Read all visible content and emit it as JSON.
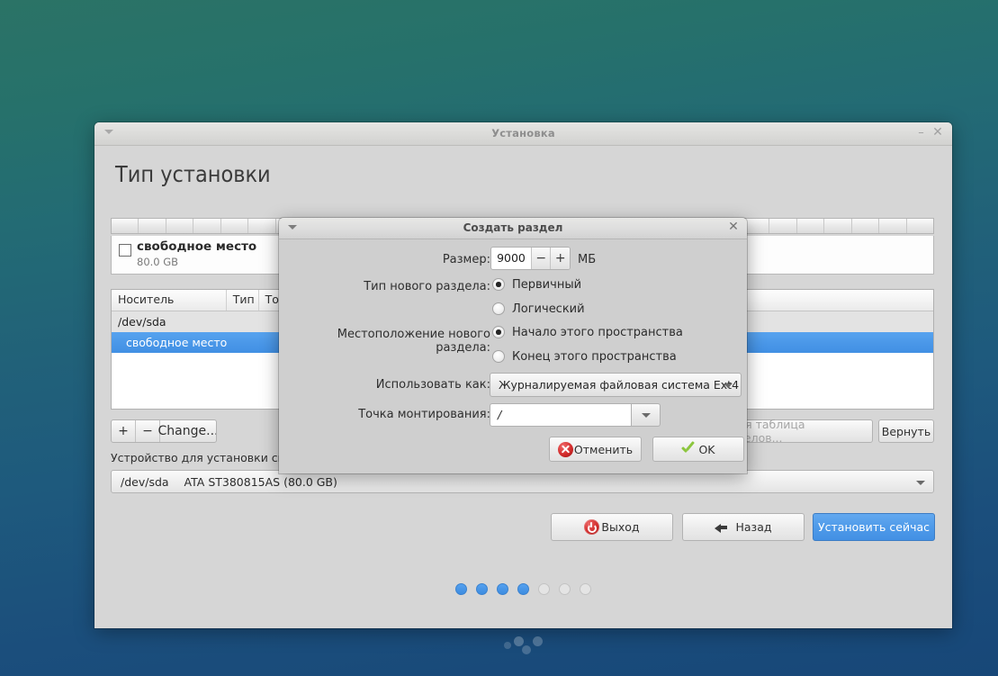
{
  "window": {
    "title": "Установка",
    "page_title": "Тип установки",
    "minimize_icon": "minimize-icon",
    "close_icon": "close-icon",
    "menu_icon": "window-menu-icon"
  },
  "legend": {
    "name": "свободное место",
    "size": "80.0 GB"
  },
  "table": {
    "columns": [
      "Носитель",
      "Тип",
      "Точ"
    ],
    "rows": [
      {
        "name": "/dev/sda",
        "type": "",
        "mount": "",
        "selected": false
      },
      {
        "name": "свободное место",
        "type": "",
        "mount": "",
        "selected": true
      }
    ]
  },
  "toolbar": {
    "add_label": "+",
    "remove_label": "−",
    "change_label": "Change...",
    "new_table_label": "Новая таблица разделов...",
    "revert_label": "Вернуть"
  },
  "device": {
    "label": "Устройство для установки системного загрузчика:",
    "selected_dev": "/dev/sda",
    "selected_desc": "ATA ST380815AS (80.0 GB)"
  },
  "nav": {
    "quit_label": "Выход",
    "back_label": "Назад",
    "install_label": "Установить сейчас",
    "quit_icon": "power-icon",
    "back_icon": "arrow-left-icon"
  },
  "dots": {
    "total": 7,
    "active": 4
  },
  "dialog": {
    "title": "Создать раздел",
    "close_icon": "close-icon",
    "menu_icon": "window-menu-icon",
    "size": {
      "label": "Размер:",
      "value": "9000",
      "unit": "МБ",
      "decrement": "−",
      "increment": "+"
    },
    "part_type": {
      "label": "Тип нового раздела:",
      "options": [
        {
          "label": "Первичный",
          "checked": true
        },
        {
          "label": "Логический",
          "checked": false
        }
      ]
    },
    "location": {
      "label": "Местоположение нового раздела:",
      "options": [
        {
          "label": "Начало этого пространства",
          "checked": true
        },
        {
          "label": "Конец этого пространства",
          "checked": false
        }
      ]
    },
    "use_as": {
      "label": "Использовать как:",
      "value": "Журналируемая файловая система Ext4"
    },
    "mount_point": {
      "label": "Точка монтирования:",
      "value": "/"
    },
    "buttons": {
      "cancel_label": "Отменить",
      "ok_label": "OK",
      "cancel_icon": "error-circle-icon",
      "ok_icon": "check-icon"
    }
  },
  "colors": {
    "accent_blue": "#4a97e8",
    "desktop_top": "#2b7366",
    "desktop_bottom": "#174778"
  }
}
